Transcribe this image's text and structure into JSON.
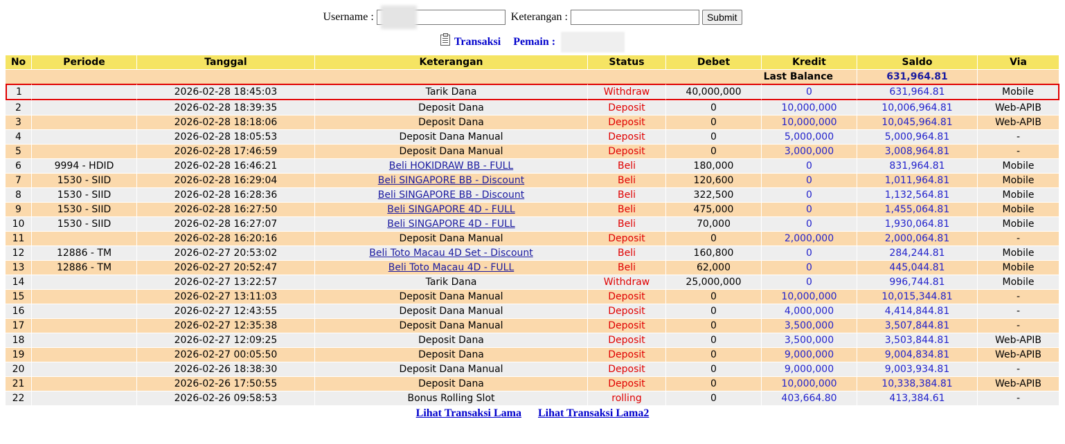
{
  "form": {
    "username_label": "Username :",
    "username_value": "",
    "keterangan_label": "Keterangan :",
    "keterangan_value": "",
    "submit_label": "Submit"
  },
  "title": {
    "transaksi": "Transaksi",
    "pemain_label": "Pemain :"
  },
  "columns": [
    "No",
    "Periode",
    "Tanggal",
    "Keterangan",
    "Status",
    "Debet",
    "Kredit",
    "Saldo",
    "Via"
  ],
  "last_balance": {
    "label": "Last Balance",
    "value": "631,964.81"
  },
  "rows": [
    {
      "no": "1",
      "periode": "",
      "tanggal": "2026-02-28 18:45:03",
      "keterangan": "Tarik Dana",
      "link": false,
      "status": "Withdraw",
      "debet": "40,000,000",
      "kredit": "0",
      "saldo": "631,964.81",
      "via": "Mobile"
    },
    {
      "no": "2",
      "periode": "",
      "tanggal": "2026-02-28 18:39:35",
      "keterangan": "Deposit Dana",
      "link": false,
      "status": "Deposit",
      "debet": "0",
      "kredit": "10,000,000",
      "saldo": "10,006,964.81",
      "via": "Web-APIB"
    },
    {
      "no": "3",
      "periode": "",
      "tanggal": "2026-02-28 18:18:06",
      "keterangan": "Deposit Dana",
      "link": false,
      "status": "Deposit",
      "debet": "0",
      "kredit": "10,000,000",
      "saldo": "10,045,964.81",
      "via": "Web-APIB"
    },
    {
      "no": "4",
      "periode": "",
      "tanggal": "2026-02-28 18:05:53",
      "keterangan": "Deposit Dana Manual",
      "link": false,
      "status": "Deposit",
      "debet": "0",
      "kredit": "5,000,000",
      "saldo": "5,000,964.81",
      "via": "-"
    },
    {
      "no": "5",
      "periode": "",
      "tanggal": "2026-02-28 17:46:59",
      "keterangan": "Deposit Dana Manual",
      "link": false,
      "status": "Deposit",
      "debet": "0",
      "kredit": "3,000,000",
      "saldo": "3,008,964.81",
      "via": "-"
    },
    {
      "no": "6",
      "periode": "9994 - HDID",
      "tanggal": "2026-02-28 16:46:21",
      "keterangan": "Beli HOKIDRAW BB - FULL",
      "link": true,
      "status": "Beli",
      "debet": "180,000",
      "kredit": "0",
      "saldo": "831,964.81",
      "via": "Mobile"
    },
    {
      "no": "7",
      "periode": "1530 - SIID",
      "tanggal": "2026-02-28 16:29:04",
      "keterangan": "Beli SINGAPORE BB - Discount",
      "link": true,
      "status": "Beli",
      "debet": "120,600",
      "kredit": "0",
      "saldo": "1,011,964.81",
      "via": "Mobile"
    },
    {
      "no": "8",
      "periode": "1530 - SIID",
      "tanggal": "2026-02-28 16:28:36",
      "keterangan": "Beli SINGAPORE BB - Discount",
      "link": true,
      "status": "Beli",
      "debet": "322,500",
      "kredit": "0",
      "saldo": "1,132,564.81",
      "via": "Mobile"
    },
    {
      "no": "9",
      "periode": "1530 - SIID",
      "tanggal": "2026-02-28 16:27:50",
      "keterangan": "Beli SINGAPORE 4D - FULL",
      "link": true,
      "status": "Beli",
      "debet": "475,000",
      "kredit": "0",
      "saldo": "1,455,064.81",
      "via": "Mobile"
    },
    {
      "no": "10",
      "periode": "1530 - SIID",
      "tanggal": "2026-02-28 16:27:07",
      "keterangan": "Beli SINGAPORE 4D - FULL",
      "link": true,
      "status": "Beli",
      "debet": "70,000",
      "kredit": "0",
      "saldo": "1,930,064.81",
      "via": "Mobile"
    },
    {
      "no": "11",
      "periode": "",
      "tanggal": "2026-02-28 16:20:16",
      "keterangan": "Deposit Dana Manual",
      "link": false,
      "status": "Deposit",
      "debet": "0",
      "kredit": "2,000,000",
      "saldo": "2,000,064.81",
      "via": "-"
    },
    {
      "no": "12",
      "periode": "12886 - TM",
      "tanggal": "2026-02-27 20:53:02",
      "keterangan": "Beli Toto Macau 4D Set - Discount",
      "link": true,
      "status": "Beli",
      "debet": "160,800",
      "kredit": "0",
      "saldo": "284,244.81",
      "via": "Mobile"
    },
    {
      "no": "13",
      "periode": "12886 - TM",
      "tanggal": "2026-02-27 20:52:47",
      "keterangan": "Beli Toto Macau 4D - FULL",
      "link": true,
      "status": "Beli",
      "debet": "62,000",
      "kredit": "0",
      "saldo": "445,044.81",
      "via": "Mobile"
    },
    {
      "no": "14",
      "periode": "",
      "tanggal": "2026-02-27 13:22:57",
      "keterangan": "Tarik Dana",
      "link": false,
      "status": "Withdraw",
      "debet": "25,000,000",
      "kredit": "0",
      "saldo": "996,744.81",
      "via": "Mobile"
    },
    {
      "no": "15",
      "periode": "",
      "tanggal": "2026-02-27 13:11:03",
      "keterangan": "Deposit Dana Manual",
      "link": false,
      "status": "Deposit",
      "debet": "0",
      "kredit": "10,000,000",
      "saldo": "10,015,344.81",
      "via": "-"
    },
    {
      "no": "16",
      "periode": "",
      "tanggal": "2026-02-27 12:43:55",
      "keterangan": "Deposit Dana Manual",
      "link": false,
      "status": "Deposit",
      "debet": "0",
      "kredit": "4,000,000",
      "saldo": "4,414,844.81",
      "via": "-"
    },
    {
      "no": "17",
      "periode": "",
      "tanggal": "2026-02-27 12:35:38",
      "keterangan": "Deposit Dana Manual",
      "link": false,
      "status": "Deposit",
      "debet": "0",
      "kredit": "3,500,000",
      "saldo": "3,507,844.81",
      "via": "-"
    },
    {
      "no": "18",
      "periode": "",
      "tanggal": "2026-02-27 12:09:25",
      "keterangan": "Deposit Dana",
      "link": false,
      "status": "Deposit",
      "debet": "0",
      "kredit": "3,500,000",
      "saldo": "3,503,844.81",
      "via": "Web-APIB"
    },
    {
      "no": "19",
      "periode": "",
      "tanggal": "2026-02-27 00:05:50",
      "keterangan": "Deposit Dana",
      "link": false,
      "status": "Deposit",
      "debet": "0",
      "kredit": "9,000,000",
      "saldo": "9,004,834.81",
      "via": "Web-APIB"
    },
    {
      "no": "20",
      "periode": "",
      "tanggal": "2026-02-26 18:38:30",
      "keterangan": "Deposit Dana Manual",
      "link": false,
      "status": "Deposit",
      "debet": "0",
      "kredit": "9,000,000",
      "saldo": "9,003,934.81",
      "via": "-"
    },
    {
      "no": "21",
      "periode": "",
      "tanggal": "2026-02-26 17:50:55",
      "keterangan": "Deposit Dana",
      "link": false,
      "status": "Deposit",
      "debet": "0",
      "kredit": "10,000,000",
      "saldo": "10,338,384.81",
      "via": "Web-APIB"
    },
    {
      "no": "22",
      "periode": "",
      "tanggal": "2026-02-26 09:58:53",
      "keterangan": "Bonus Rolling Slot",
      "link": false,
      "status": "rolling",
      "debet": "0",
      "kredit": "403,664.80",
      "saldo": "413,384.61",
      "via": "-"
    }
  ],
  "footer": {
    "link1": "Lihat Transaksi Lama",
    "link2": "Lihat Transaksi Lama2"
  },
  "colors": {
    "header_bg": "#f5e463",
    "row_odd_bg": "#fbd9ac",
    "row_even_bg": "#eeeeee",
    "status_red": "#e00000",
    "value_blue": "#2222cc",
    "highlight_border": "#e00000"
  }
}
